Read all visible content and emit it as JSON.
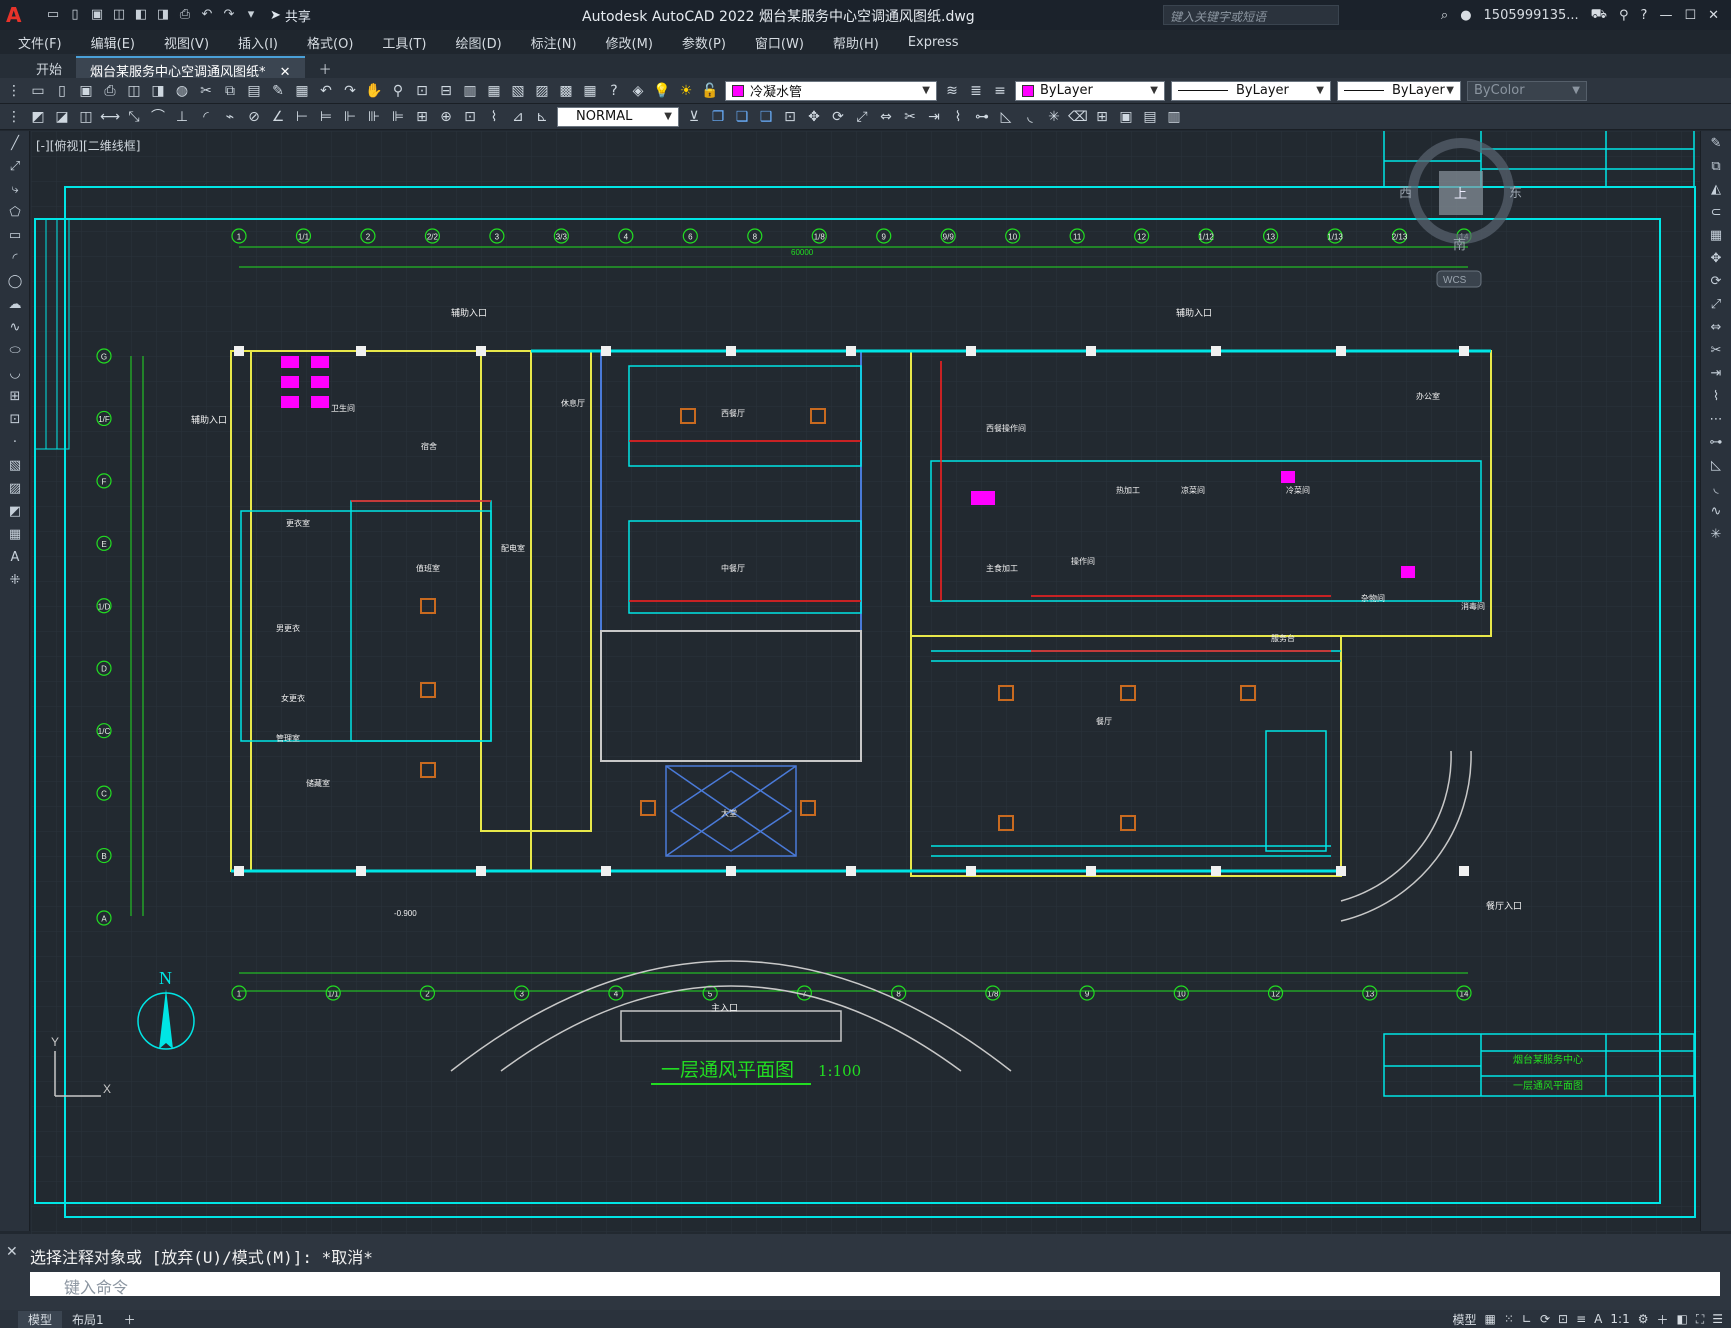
{
  "app": {
    "title": "Autodesk AutoCAD 2022    烟台某服务中心空调通风图纸.dwg",
    "share_label": "共享",
    "search_placeholder": "键入关键字或短语",
    "user": "1505999135...",
    "logo": "A"
  },
  "menu": [
    "文件(F)",
    "编辑(E)",
    "视图(V)",
    "插入(I)",
    "格式(O)",
    "工具(T)",
    "绘图(D)",
    "标注(N)",
    "修改(M)",
    "参数(P)",
    "窗口(W)",
    "帮助(H)",
    "Express"
  ],
  "tabs": {
    "start": "开始",
    "drawing": "烟台某服务中心空调通风图纸*"
  },
  "layer_toolbar": {
    "layer": "冷凝水管",
    "color": "ByLayer",
    "linetype": "ByLayer",
    "lineweight": "ByLayer",
    "plotstyle": "ByColor"
  },
  "draw_toolbar": {
    "style": "NORMAL"
  },
  "viewport": {
    "label": "[-][俯视][二维线框]",
    "viewcube_west": "西",
    "viewcube_east": "东",
    "viewcube_south": "南",
    "viewcube_top": "上",
    "wcs": "WCS"
  },
  "drawing": {
    "title": "一层通风平面图",
    "scale": "1:100",
    "north": "N",
    "grid_top": [
      "1",
      "1/1",
      "2",
      "2/2",
      "3",
      "3/3",
      "4",
      "6",
      "8",
      "1/8",
      "9",
      "9/9",
      "10",
      "11",
      "12",
      "1/12",
      "13",
      "1/13",
      "2/13",
      "14"
    ],
    "grid_bottom": [
      "1",
      "1/1",
      "2",
      "3",
      "4",
      "5",
      "7",
      "8",
      "1/8",
      "9",
      "10",
      "12",
      "13",
      "14"
    ],
    "grid_left": [
      "G",
      "1/F",
      "F",
      "E",
      "1/D",
      "D",
      "1/C",
      "C",
      "B",
      "A"
    ],
    "dim_total": "60000",
    "rooms": [
      "更衣室",
      "宿舍",
      "值班室",
      "操作间",
      "主食加工",
      "餐厅",
      "服务台",
      "储藏室",
      "卫生间",
      "休息厅",
      "西餐厅",
      "中餐厅",
      "大堂",
      "男更衣",
      "女更衣",
      "管理室",
      "配电室",
      "办公室",
      "杂物间",
      "冷菜间",
      "消毒间",
      "热加工",
      "凉菜间",
      "西餐操作间"
    ],
    "labels": {
      "entrance_main": "主入口",
      "entrance_1": "辅助入口",
      "entrance_2": "辅助入口",
      "entrance_3": "辅助入口",
      "entrance_4": "餐厅入口",
      "lobby": "大堂",
      "elev": "-0.900"
    },
    "titleblock_top": {
      "project": "烟台某服务中心",
      "drawing": "一层通风平面图"
    }
  },
  "command": {
    "history": "选择注释对象或 [放弃(U)/模式(M)]: *取消*",
    "placeholder": "键入命令"
  },
  "status": {
    "model_tab": "模型",
    "layout_tab": "布局1",
    "model_label": "模型",
    "scale": "1:1"
  },
  "colors": {
    "cyan": "#00ffff",
    "green": "#22dd22",
    "yellow": "#e8e84a",
    "magenta": "#ff00ff",
    "red": "#ff2020",
    "orange": "#c86a20",
    "blue": "#4a7ad8"
  }
}
